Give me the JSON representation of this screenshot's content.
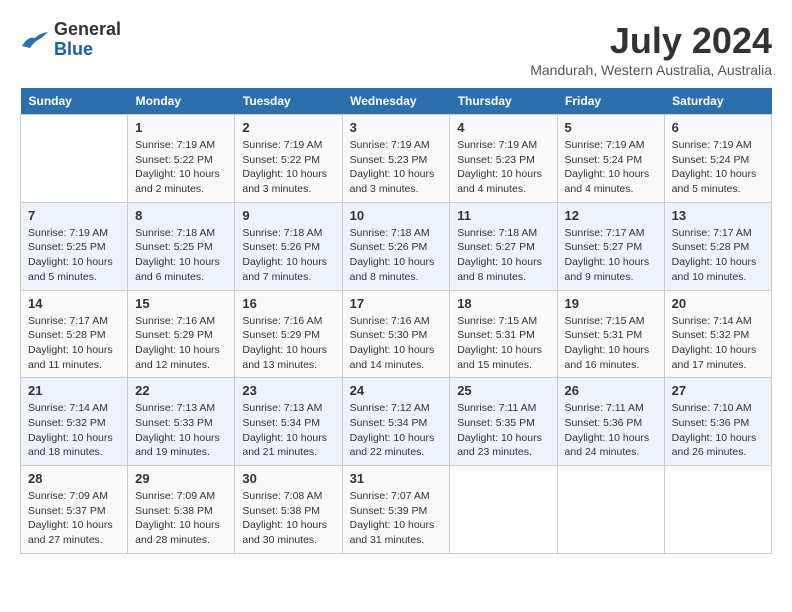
{
  "logo": {
    "text_general": "General",
    "text_blue": "Blue"
  },
  "title": {
    "month_year": "July 2024",
    "location": "Mandurah, Western Australia, Australia"
  },
  "calendar": {
    "headers": [
      "Sunday",
      "Monday",
      "Tuesday",
      "Wednesday",
      "Thursday",
      "Friday",
      "Saturday"
    ],
    "weeks": [
      [
        {
          "day": "",
          "info": ""
        },
        {
          "day": "1",
          "info": "Sunrise: 7:19 AM\nSunset: 5:22 PM\nDaylight: 10 hours\nand 2 minutes."
        },
        {
          "day": "2",
          "info": "Sunrise: 7:19 AM\nSunset: 5:22 PM\nDaylight: 10 hours\nand 3 minutes."
        },
        {
          "day": "3",
          "info": "Sunrise: 7:19 AM\nSunset: 5:23 PM\nDaylight: 10 hours\nand 3 minutes."
        },
        {
          "day": "4",
          "info": "Sunrise: 7:19 AM\nSunset: 5:23 PM\nDaylight: 10 hours\nand 4 minutes."
        },
        {
          "day": "5",
          "info": "Sunrise: 7:19 AM\nSunset: 5:24 PM\nDaylight: 10 hours\nand 4 minutes."
        },
        {
          "day": "6",
          "info": "Sunrise: 7:19 AM\nSunset: 5:24 PM\nDaylight: 10 hours\nand 5 minutes."
        }
      ],
      [
        {
          "day": "7",
          "info": "Sunrise: 7:19 AM\nSunset: 5:25 PM\nDaylight: 10 hours\nand 5 minutes."
        },
        {
          "day": "8",
          "info": "Sunrise: 7:18 AM\nSunset: 5:25 PM\nDaylight: 10 hours\nand 6 minutes."
        },
        {
          "day": "9",
          "info": "Sunrise: 7:18 AM\nSunset: 5:26 PM\nDaylight: 10 hours\nand 7 minutes."
        },
        {
          "day": "10",
          "info": "Sunrise: 7:18 AM\nSunset: 5:26 PM\nDaylight: 10 hours\nand 8 minutes."
        },
        {
          "day": "11",
          "info": "Sunrise: 7:18 AM\nSunset: 5:27 PM\nDaylight: 10 hours\nand 8 minutes."
        },
        {
          "day": "12",
          "info": "Sunrise: 7:17 AM\nSunset: 5:27 PM\nDaylight: 10 hours\nand 9 minutes."
        },
        {
          "day": "13",
          "info": "Sunrise: 7:17 AM\nSunset: 5:28 PM\nDaylight: 10 hours\nand 10 minutes."
        }
      ],
      [
        {
          "day": "14",
          "info": "Sunrise: 7:17 AM\nSunset: 5:28 PM\nDaylight: 10 hours\nand 11 minutes."
        },
        {
          "day": "15",
          "info": "Sunrise: 7:16 AM\nSunset: 5:29 PM\nDaylight: 10 hours\nand 12 minutes."
        },
        {
          "day": "16",
          "info": "Sunrise: 7:16 AM\nSunset: 5:29 PM\nDaylight: 10 hours\nand 13 minutes."
        },
        {
          "day": "17",
          "info": "Sunrise: 7:16 AM\nSunset: 5:30 PM\nDaylight: 10 hours\nand 14 minutes."
        },
        {
          "day": "18",
          "info": "Sunrise: 7:15 AM\nSunset: 5:31 PM\nDaylight: 10 hours\nand 15 minutes."
        },
        {
          "day": "19",
          "info": "Sunrise: 7:15 AM\nSunset: 5:31 PM\nDaylight: 10 hours\nand 16 minutes."
        },
        {
          "day": "20",
          "info": "Sunrise: 7:14 AM\nSunset: 5:32 PM\nDaylight: 10 hours\nand 17 minutes."
        }
      ],
      [
        {
          "day": "21",
          "info": "Sunrise: 7:14 AM\nSunset: 5:32 PM\nDaylight: 10 hours\nand 18 minutes."
        },
        {
          "day": "22",
          "info": "Sunrise: 7:13 AM\nSunset: 5:33 PM\nDaylight: 10 hours\nand 19 minutes."
        },
        {
          "day": "23",
          "info": "Sunrise: 7:13 AM\nSunset: 5:34 PM\nDaylight: 10 hours\nand 21 minutes."
        },
        {
          "day": "24",
          "info": "Sunrise: 7:12 AM\nSunset: 5:34 PM\nDaylight: 10 hours\nand 22 minutes."
        },
        {
          "day": "25",
          "info": "Sunrise: 7:11 AM\nSunset: 5:35 PM\nDaylight: 10 hours\nand 23 minutes."
        },
        {
          "day": "26",
          "info": "Sunrise: 7:11 AM\nSunset: 5:36 PM\nDaylight: 10 hours\nand 24 minutes."
        },
        {
          "day": "27",
          "info": "Sunrise: 7:10 AM\nSunset: 5:36 PM\nDaylight: 10 hours\nand 26 minutes."
        }
      ],
      [
        {
          "day": "28",
          "info": "Sunrise: 7:09 AM\nSunset: 5:37 PM\nDaylight: 10 hours\nand 27 minutes."
        },
        {
          "day": "29",
          "info": "Sunrise: 7:09 AM\nSunset: 5:38 PM\nDaylight: 10 hours\nand 28 minutes."
        },
        {
          "day": "30",
          "info": "Sunrise: 7:08 AM\nSunset: 5:38 PM\nDaylight: 10 hours\nand 30 minutes."
        },
        {
          "day": "31",
          "info": "Sunrise: 7:07 AM\nSunset: 5:39 PM\nDaylight: 10 hours\nand 31 minutes."
        },
        {
          "day": "",
          "info": ""
        },
        {
          "day": "",
          "info": ""
        },
        {
          "day": "",
          "info": ""
        }
      ]
    ]
  }
}
